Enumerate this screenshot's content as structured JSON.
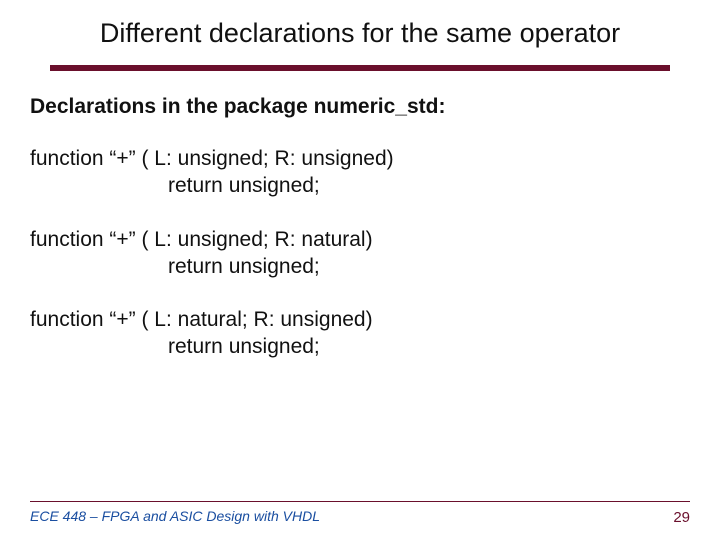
{
  "title": "Different declarations for the same operator",
  "subheading": "Declarations in the package numeric_std:",
  "declarations": [
    {
      "line1": "function “+” ( L: unsigned;  R: unsigned)",
      "line2": "return unsigned;"
    },
    {
      "line1": "function “+” ( L: unsigned;  R: natural)",
      "line2": "return unsigned;"
    },
    {
      "line1": "function “+” ( L: natural; R: unsigned)",
      "line2": "return unsigned;"
    }
  ],
  "footer": "ECE 448 – FPGA and ASIC Design with VHDL",
  "page_number": "29"
}
